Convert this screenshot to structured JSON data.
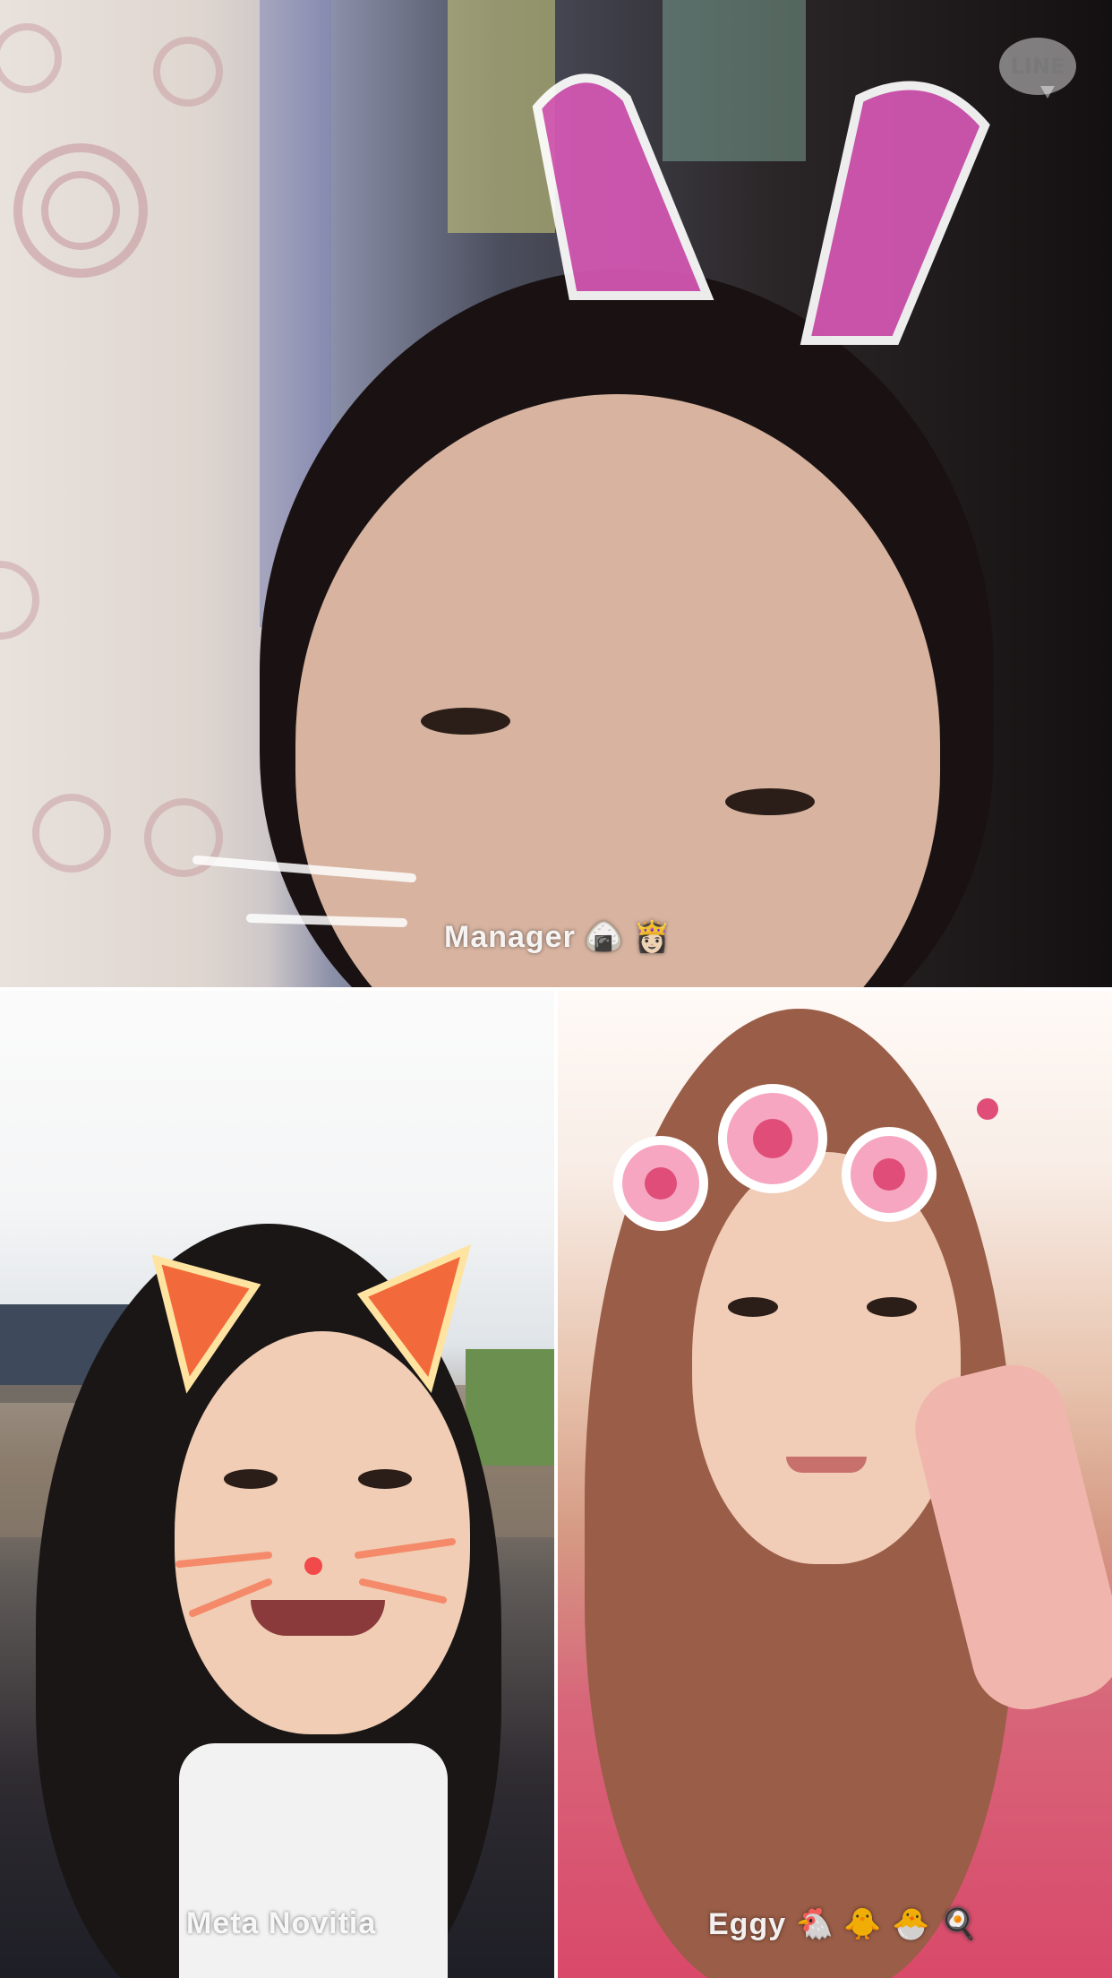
{
  "app": {
    "logo_text": "LINE"
  },
  "participants": [
    {
      "name": "Manager",
      "emojis": "🍙 👸🏻"
    },
    {
      "name": "Meta Novitia",
      "emojis": ""
    },
    {
      "name": "Eggy",
      "emojis": "🐔 🐥 🐣 🍳"
    }
  ],
  "colors": {
    "divider": "#ffffff",
    "label": "#ffffff"
  }
}
